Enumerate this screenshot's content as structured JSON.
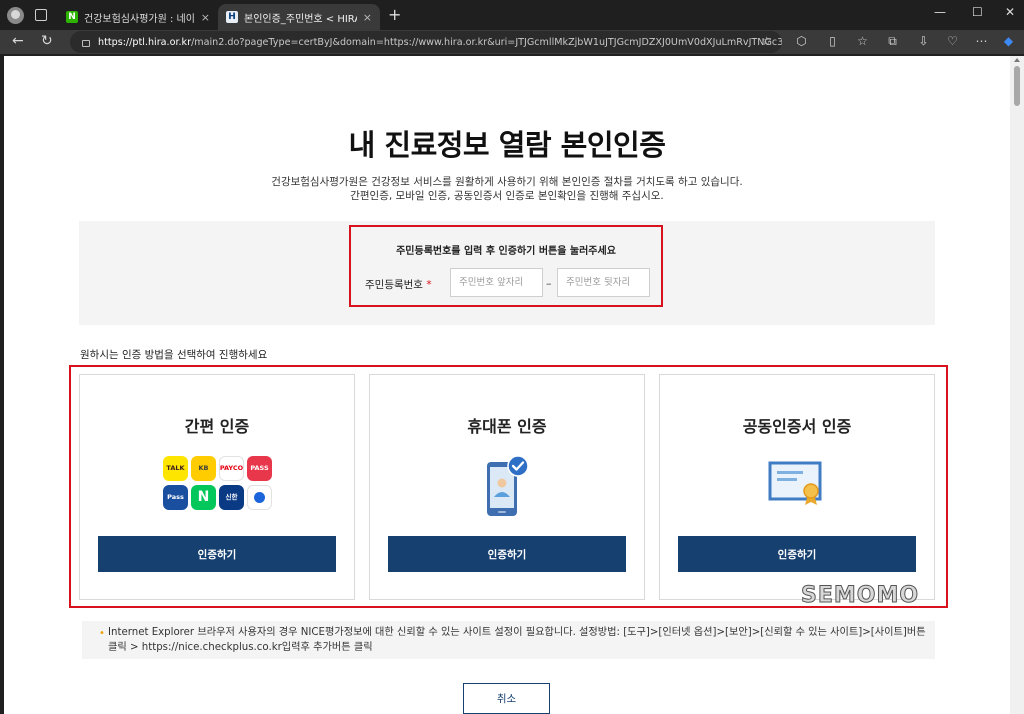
{
  "browser": {
    "tabs": [
      {
        "favicon": "N",
        "title": "건강보험심사평가원 : 네이버 검색",
        "close": "×"
      },
      {
        "favicon": "H",
        "title": "본인인증_주민번호 < HIRA포털 &",
        "close": "×"
      }
    ],
    "new_tab": "+",
    "window_controls": {
      "minimize": "—",
      "maximize": "☐",
      "close": "✕"
    },
    "url_host": "https://ptl.hira.or.kr",
    "url_rest": "/main2.do?pageType=certByJ&domain=https://www.hira.or.kr&uri=JTJGcmllMkZjbW1uJTJGcmJDZXJ0UmV0dXJuLmRvJTNGc3RyUGFnZ..."
  },
  "page": {
    "title": "내 진료정보 열람 본인인증",
    "desc_line1": "건강보험심사평가원은 건강정보 서비스를 원활하게 사용하기 위해 본인인증 절차를 거치도록 하고 있습니다.",
    "desc_line2": "간편인증, 모바일 인증, 공동인증서 인증로 본인확인을 진행해 주십시오.",
    "id_section": {
      "instruction": "주민등록번호를 입력 후 인증하기 버튼을 눌러주세요",
      "label": "주민등록번호",
      "required_mark": "*",
      "front_placeholder": "주민번호 앞자리",
      "back_placeholder": "주민번호 뒷자리",
      "separator": "–"
    },
    "choose_method": "원하시는 인증 방법을 선택하여 진행하세요",
    "methods": [
      {
        "title": "간편 인증",
        "button": "인증하기"
      },
      {
        "title": "휴대폰 인증",
        "button": "인증하기"
      },
      {
        "title": "공동인증서 인증",
        "button": "인증하기"
      }
    ],
    "simple_auth_apps": [
      {
        "name": "kakao-talk-icon",
        "label": "TALK",
        "bg": "#fee500",
        "fg": "#3b1e1e"
      },
      {
        "name": "kb-icon",
        "label": "KB",
        "bg": "#ffcc00",
        "fg": "#3b3b3b"
      },
      {
        "name": "payco-icon",
        "label": "PAYCO",
        "bg": "#ffffff",
        "fg": "#e60012"
      },
      {
        "name": "pass-icon",
        "label": "PASS",
        "bg": "#e8364a",
        "fg": "#ffffff"
      },
      {
        "name": "samsung-pass-icon",
        "label": "Pass",
        "bg": "#1a4fa0",
        "fg": "#ffffff"
      },
      {
        "name": "naver-icon",
        "label": "N",
        "bg": "#03c75a",
        "fg": "#ffffff"
      },
      {
        "name": "shinhan-icon",
        "label": "신한",
        "bg": "#0a3a84",
        "fg": "#ffffff"
      },
      {
        "name": "toss-icon",
        "label": "",
        "bg": "#ffffff",
        "fg": "#1b64da"
      }
    ],
    "notice": "Internet Explorer 브라우저 사용자의 경우 NICE평가정보에 대한 신뢰할 수 있는 사이트 설정이 필요합니다. 설정방법: [도구]>[인터넷 옵션]>[보안]>[신뢰할 수 있는 사이트]>[사이트]버튼 클릭 > https://nice.checkplus.co.kr입력후 추가버튼 클릭",
    "cancel": "취소"
  },
  "watermark": "SEMOMO",
  "colors": {
    "primary": "#16406f",
    "highlight": "#d7121c",
    "panel": "#f4f4f4"
  }
}
